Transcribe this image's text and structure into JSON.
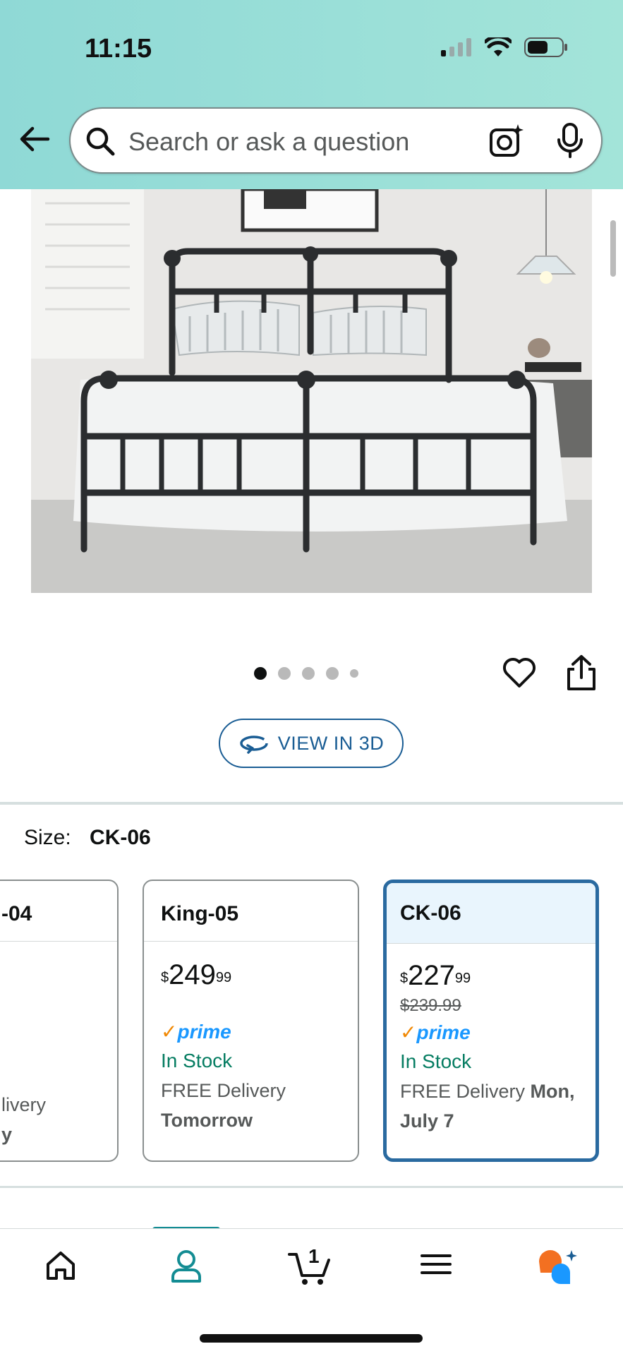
{
  "status_bar": {
    "time": "11:15"
  },
  "search": {
    "placeholder": "Search or ask a question"
  },
  "gallery": {
    "image_alt": "Black metal platform bed frame with headboard and footboard in bedroom",
    "dot_count": 5,
    "active_index": 0
  },
  "view3d": {
    "label": "VIEW IN 3D"
  },
  "size": {
    "label": "Size:",
    "selected": "CK-06"
  },
  "size_cards": [
    {
      "title": "-04",
      "price_whole": "",
      "price_fraction": "",
      "list_price": "",
      "prime": false,
      "stock": "",
      "delivery_line1": "livery",
      "delivery_line2": "y"
    },
    {
      "title": "King-05",
      "price_currency": "$",
      "price_whole": "249",
      "price_fraction": "99",
      "list_price": "",
      "prime": true,
      "stock": "In Stock",
      "delivery_text": "FREE Delivery",
      "delivery_date": "Tomorrow"
    },
    {
      "title": "CK-06",
      "price_currency": "$",
      "price_whole": "227",
      "price_fraction": "99",
      "list_price": "$239.99",
      "prime": true,
      "stock": "In Stock",
      "delivery_text": "FREE Delivery",
      "delivery_date": "Mon, July 7"
    }
  ],
  "prime_label": "prime",
  "tabbar": {
    "cart_count": "1",
    "active_tab": "profile"
  },
  "colors": {
    "accent": "#2a6aa0",
    "teal": "#138c93",
    "stock_green": "#067d62",
    "prime_blue": "#1a98ff"
  }
}
